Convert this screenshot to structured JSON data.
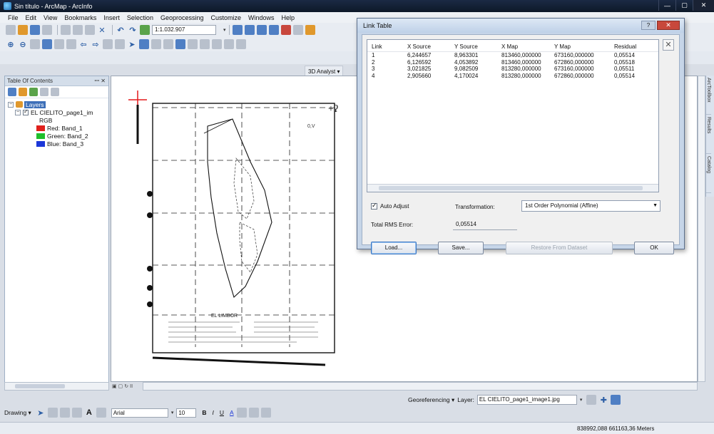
{
  "window": {
    "title": "Sin título - ArcMap - ArcInfo"
  },
  "menu": [
    "File",
    "Edit",
    "View",
    "Bookmarks",
    "Insert",
    "Selection",
    "Geoprocessing",
    "Customize",
    "Windows",
    "Help"
  ],
  "toolbar": {
    "scale": "1:1.032.907",
    "analyst_label": "3D Analyst ▾"
  },
  "toc": {
    "title": "Table Of Contents",
    "close": "✕",
    "pin": "ꟷ",
    "layers_label": "Layers",
    "layer_name": "EL CIELITO_page1_im",
    "rgb_label": "RGB",
    "bands": [
      {
        "label": "Red:  Band_1",
        "color": "#e0201b"
      },
      {
        "label": "Green:  Band_2",
        "color": "#1fbf2c"
      },
      {
        "label": "Blue:  Band_3",
        "color": "#1c37d8"
      }
    ]
  },
  "map": {
    "doc_title": "EL LIMBOR",
    "arrow_label": "0,V"
  },
  "right_tabs": [
    "ArcToolbox",
    "Results",
    "Catalog"
  ],
  "georef": {
    "label": "Georeferencing ▾",
    "layer_label": "Layer:",
    "layer_value": "EL CIELITO_page1_image1.jpg"
  },
  "drawing": {
    "label": "Drawing ▾",
    "font": "Arial",
    "size": "10",
    "bold": "B",
    "italic": "I",
    "underline": "U",
    "font_color": "A"
  },
  "status": {
    "coords": "838992,088  661163,36 Meters"
  },
  "dialog": {
    "title": "Link Table",
    "help": "?",
    "close": "✕",
    "columns": [
      "Link",
      "X Source",
      "Y Source",
      "X Map",
      "Y Map",
      "Residual"
    ],
    "rows": [
      [
        "1",
        "6,244657",
        "8,963301",
        "813460,000000",
        "673160,000000",
        "0,05514"
      ],
      [
        "2",
        "6,126592",
        "4,053892",
        "813460,000000",
        "672860,000000",
        "0,05518"
      ],
      [
        "3",
        "3,021825",
        "9,082509",
        "813280,000000",
        "673160,000000",
        "0,05511"
      ],
      [
        "4",
        "2,905660",
        "4,170024",
        "813280,000000",
        "672860,000000",
        "0,05514"
      ]
    ],
    "auto_adjust": "Auto Adjust",
    "transformation_label": "Transformation:",
    "transformation_value": "1st Order Polynomial (Affine)",
    "rms_label": "Total RMS Error:",
    "rms_value": "0,05514",
    "buttons": {
      "load": "Load...",
      "save": "Save...",
      "restore": "Restore From Dataset",
      "ok": "OK"
    }
  }
}
